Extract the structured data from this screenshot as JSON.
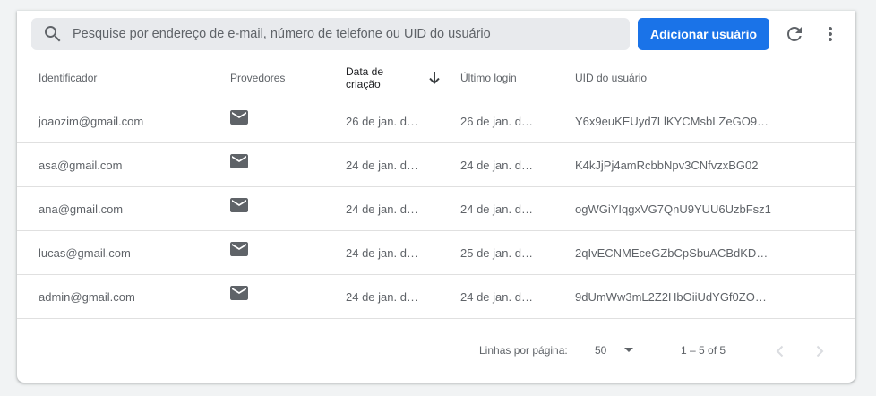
{
  "search": {
    "placeholder": "Pesquise por endereço de e-mail, número de telefone ou UID do usuário"
  },
  "toolbar": {
    "add_label": "Adicionar usuário",
    "refresh_icon": "refresh-icon",
    "more_icon": "more-vert-icon"
  },
  "columns": {
    "identifier": "Identificador",
    "providers": "Provedores",
    "created_line1": "Data de",
    "created_line2": "criação",
    "last_login": "Último login",
    "uid": "UID do usuário"
  },
  "rows": [
    {
      "identifier": "joaozim@gmail.com",
      "provider_icon": "mail-icon",
      "created": "26 de jan. d…",
      "last_login": "26 de jan. d…",
      "uid": "Y6x9euKEUyd7LlKYCMsbLZeGO9…"
    },
    {
      "identifier": "asa@gmail.com",
      "provider_icon": "mail-icon",
      "created": "24 de jan. d…",
      "last_login": "24 de jan. d…",
      "uid": "K4kJjPj4amRcbbNpv3CNfvzxBG02"
    },
    {
      "identifier": "ana@gmail.com",
      "provider_icon": "mail-icon",
      "created": "24 de jan. d…",
      "last_login": "24 de jan. d…",
      "uid": "ogWGiYIqgxVG7QnU9YUU6UzbFsz1"
    },
    {
      "identifier": "lucas@gmail.com",
      "provider_icon": "mail-icon",
      "created": "24 de jan. d…",
      "last_login": "25 de jan. d…",
      "uid": "2qIvECNMEceGZbCpSbuACBdKD…"
    },
    {
      "identifier": "admin@gmail.com",
      "provider_icon": "mail-icon",
      "created": "24 de jan. d…",
      "last_login": "24 de jan. d…",
      "uid": "9dUmWw3mL2Z2HbOiiUdYGf0ZO…"
    }
  ],
  "pagination": {
    "rows_per_page_label": "Linhas por página:",
    "rows_per_page": "50",
    "range": "1 – 5 of 5"
  },
  "colors": {
    "accent": "#1a73e8",
    "icon": "#5f6368",
    "background": "#f1f3f4"
  }
}
